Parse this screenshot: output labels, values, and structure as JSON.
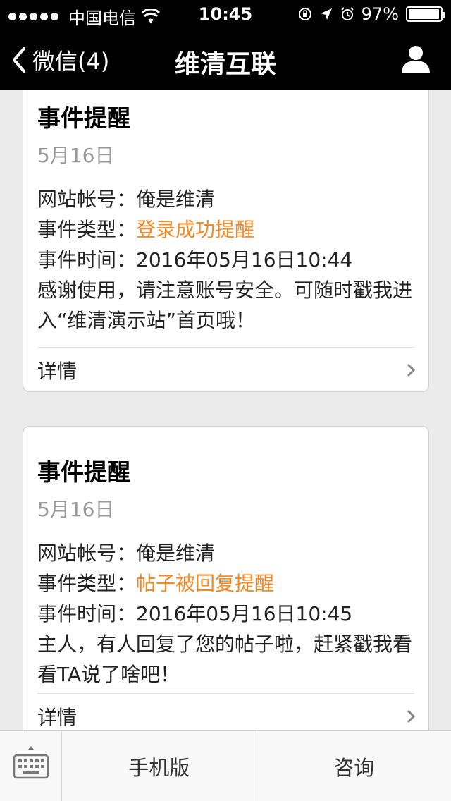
{
  "status_bar": {
    "carrier": "中国电信",
    "time": "10:45",
    "battery": "97%",
    "battery_level": 0.97
  },
  "nav": {
    "back_label": "微信(4)",
    "title": "维清互联"
  },
  "cards": [
    {
      "title": "事件提醒",
      "date": "5月16日",
      "rows": [
        {
          "label": "网站帐号：",
          "value": "俺是维清"
        },
        {
          "label": "事件类型：",
          "value": "登录成功提醒"
        },
        {
          "label": "事件时间：",
          "value": "2016年05月16日10:44"
        }
      ],
      "message": "感谢使用，请注意账号安全。可随时戳我进入“维清演示站”首页哦！",
      "detail_label": "详情"
    },
    {
      "title": "事件提醒",
      "date": "5月16日",
      "rows": [
        {
          "label": "网站帐号：",
          "value": "俺是维清"
        },
        {
          "label": "事件类型：",
          "value": "帖子被回复提醒"
        },
        {
          "label": "事件时间：",
          "value": "2016年05月16日10:45"
        }
      ],
      "message": "主人，有人回复了您的帖子啦，赶紧戳我看看TA说了啥吧！",
      "detail_label": "详情"
    }
  ],
  "bottom_bar": {
    "keyboard_icon": "keyboard-icon",
    "menu": [
      "手机版",
      "咨询"
    ]
  },
  "colors": {
    "highlight": "#f48a26",
    "header_bg": "#000000"
  }
}
